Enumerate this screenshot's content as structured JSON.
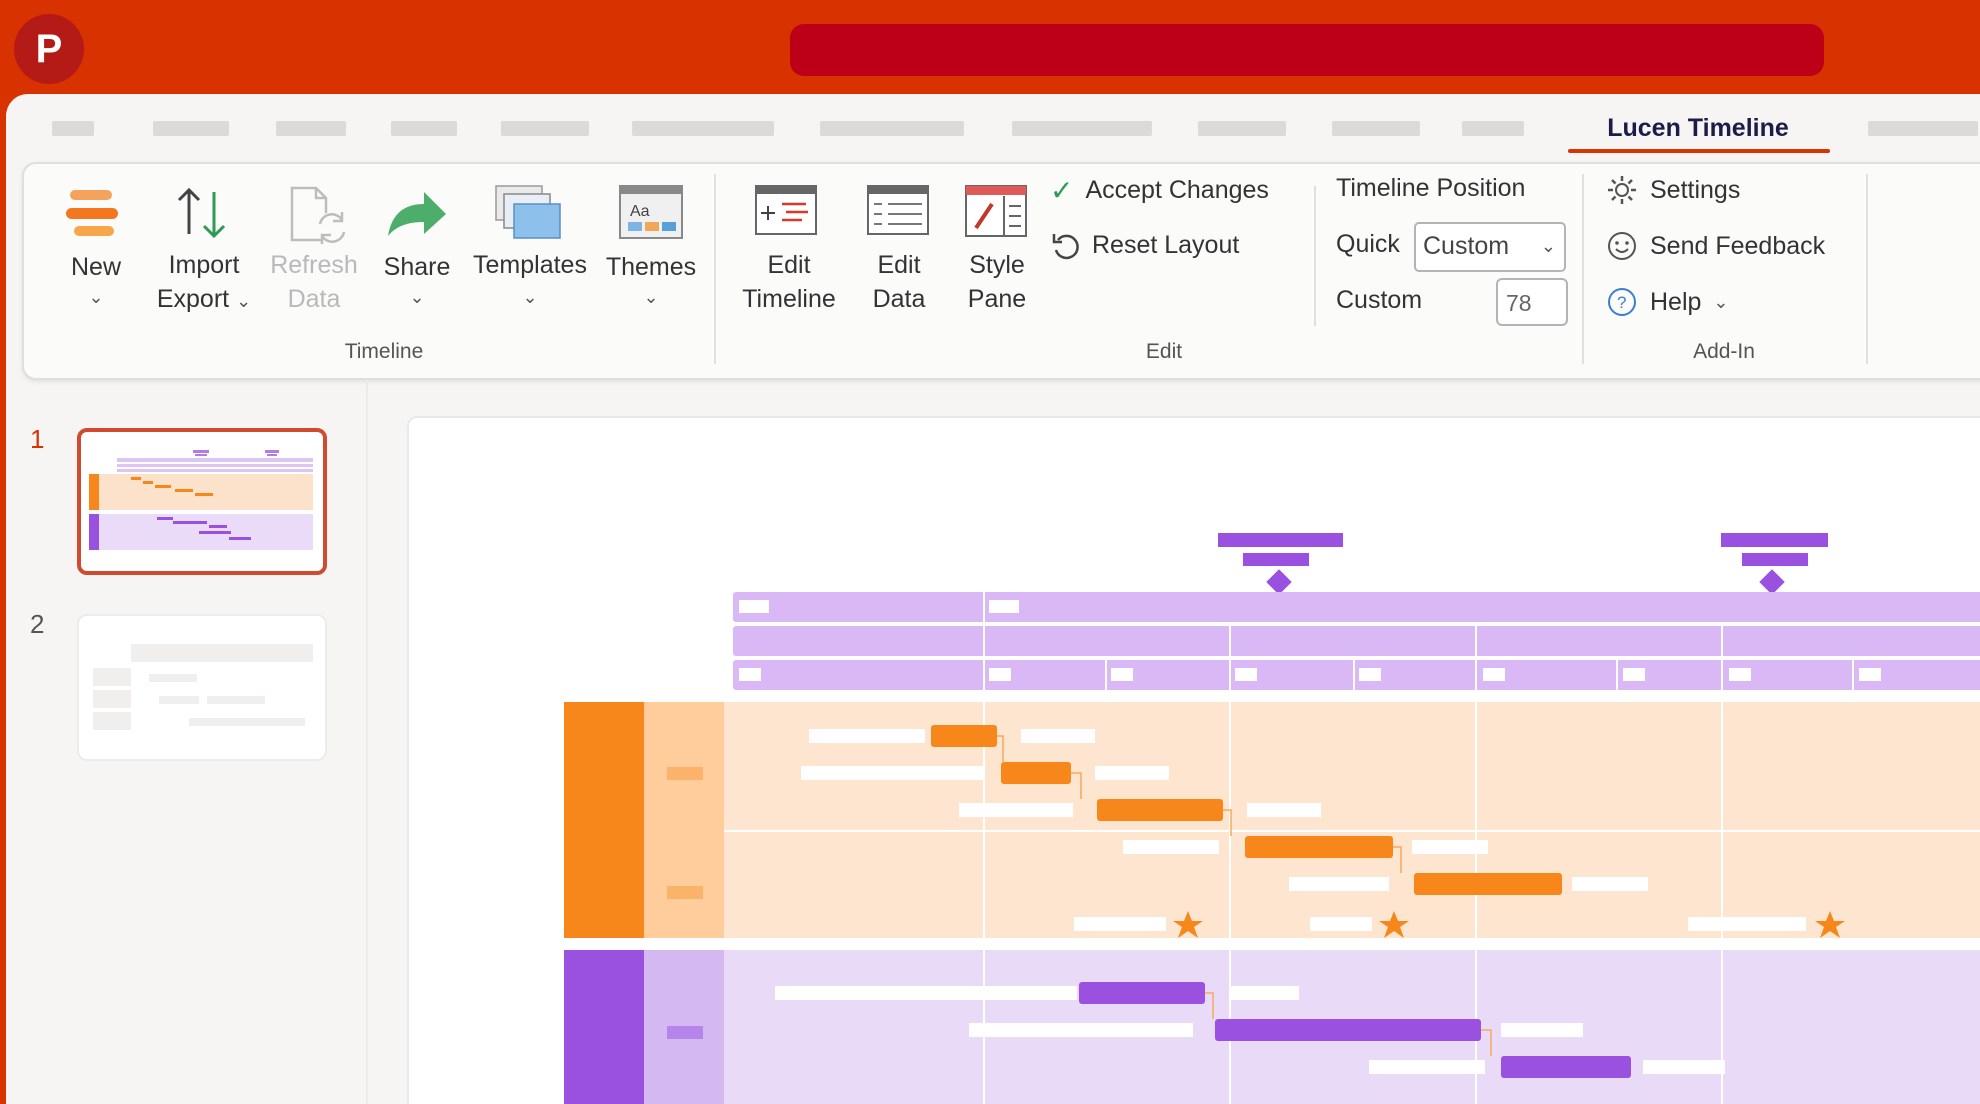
{
  "app": {
    "logo_letter": "P"
  },
  "tabs": {
    "active": "Lucen Timeline"
  },
  "ribbon": {
    "timeline": {
      "group_label": "Timeline",
      "new": "New",
      "import_label": "Import",
      "export_label": "Export",
      "refresh_line1": "Refresh",
      "refresh_line2": "Data",
      "share": "Share",
      "templates": "Templates",
      "themes": "Themes"
    },
    "edit": {
      "group_label": "Edit",
      "edit_timeline_1": "Edit",
      "edit_timeline_2": "Timeline",
      "edit_data_1": "Edit",
      "edit_data_2": "Data",
      "style_pane_1": "Style",
      "style_pane_2": "Pane",
      "accept_changes": "Accept Changes",
      "reset_layout": "Reset Layout",
      "timeline_position": "Timeline Position",
      "quick_label": "Quick",
      "quick_value": "Custom",
      "custom_label": "Custom",
      "custom_value": "78"
    },
    "addin": {
      "group_label": "Add-In",
      "settings": "Settings",
      "send_feedback": "Send Feedback",
      "help": "Help"
    }
  },
  "slides": {
    "numbers": [
      "1",
      "2"
    ]
  },
  "colors": {
    "brand": "#d83300",
    "orange": "#f7871b",
    "purple": "#9b51e0",
    "lavender": "#d9b8f5",
    "peach": "#fde5cf"
  }
}
